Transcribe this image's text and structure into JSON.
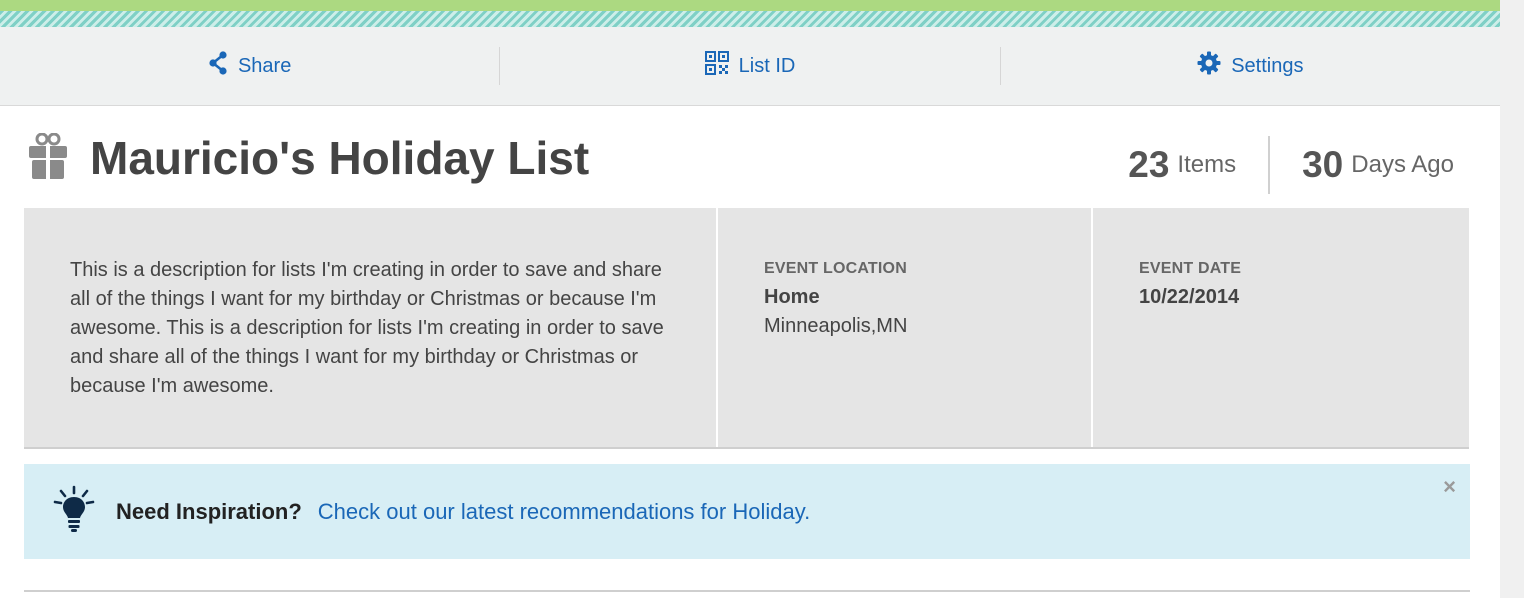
{
  "actions": {
    "share_label": "Share",
    "listid_label": "List ID",
    "settings_label": "Settings"
  },
  "list": {
    "title": "Mauricio's Holiday List",
    "items_count": "23",
    "items_label": "Items",
    "days_count": "30",
    "days_label": "Days Ago",
    "description": "This is a description for lists I'm creating in order to save and share all of the things I want for my birthday or Christmas or because I'm awesome. This is a description for lists I'm creating in order to save and share all of the things I want for my birthday or Christmas or because I'm awesome."
  },
  "event": {
    "location_label": "EVENT LOCATION",
    "location_name": "Home",
    "location_city": "Minneapolis,MN",
    "date_label": "EVENT DATE",
    "date_value": "10/22/2014"
  },
  "inspiration": {
    "title": "Need Inspiration?",
    "link": "Check out our latest recommendations for Holiday.",
    "close": "×"
  },
  "colors": {
    "link_blue": "#1a67b7",
    "banner_green": "#acd981",
    "stripe_teal": "#7fd0c6",
    "inspire_bg": "#d7eef5"
  },
  "icons": [
    "share-icon",
    "qr-code-icon",
    "gear-icon",
    "gift-icon",
    "lightbulb-icon",
    "close-icon"
  ]
}
